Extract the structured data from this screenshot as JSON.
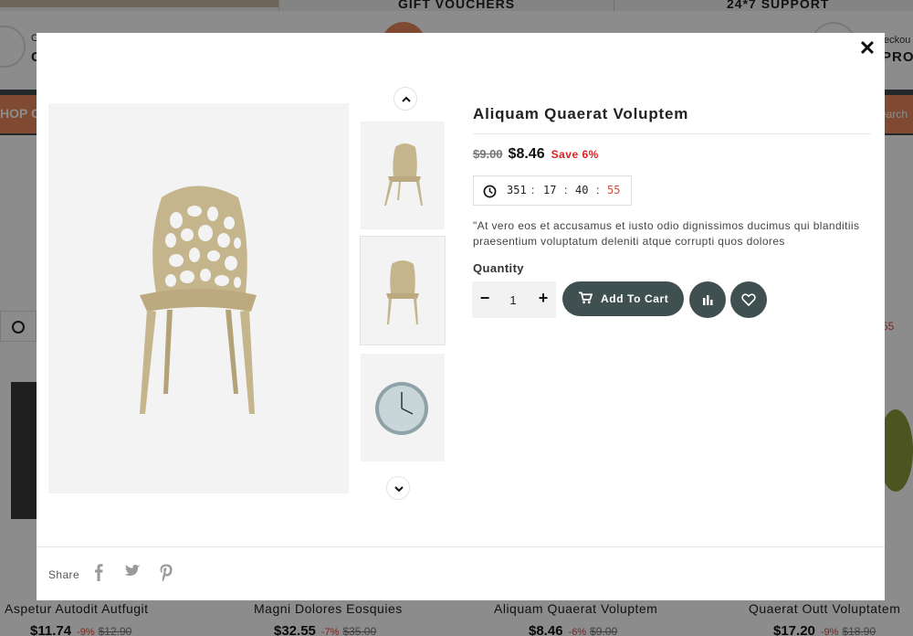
{
  "background": {
    "topbar": {
      "gift": "GIFT VOUCHERS",
      "support": "24*7 SUPPORT"
    },
    "header": {
      "left_small": "C",
      "left_big": "G",
      "right_small": "eckou",
      "right_big": "PROD"
    },
    "nav": {
      "shop_categories": "HOP CA",
      "search": "earch"
    },
    "timer_right": "55",
    "products": [
      {
        "name": "Aspetur Autodit Autfugit",
        "price": "$11.74",
        "discount": "-9%",
        "old_price": "$12.90"
      },
      {
        "name": "Magni Dolores Eosquies",
        "price": "$32.55",
        "discount": "-7%",
        "old_price": "$35.00"
      },
      {
        "name": "Aliquam Quaerat Voluptem",
        "price": "$8.46",
        "discount": "-6%",
        "old_price": "$9.00"
      },
      {
        "name": "Quaerat Outt Voluptatem",
        "price": "$17.20",
        "discount": "-9%",
        "old_price": "$18.90"
      }
    ]
  },
  "modal": {
    "close_label": "✕",
    "product": {
      "title": "Aliquam Quaerat Voluptem",
      "old_price": "$9.00",
      "price": "$8.46",
      "save": "Save 6%",
      "countdown": {
        "days": "351",
        "hours": "17",
        "minutes": "40",
        "seconds": "55"
      },
      "description": "\"At vero eos et accusamus et iusto odio dignissimos ducimus qui blanditiis praesentium voluptatum deleniti atque corrupti quos dolores",
      "quantity_label": "Quantity",
      "quantity_value": "1",
      "add_to_cart_label": "Add To Cart"
    },
    "thumbnails": [
      {
        "icon": "chair-icon"
      },
      {
        "icon": "chair-icon"
      },
      {
        "icon": "wall-clock-icon"
      }
    ],
    "share_label": "Share",
    "social": [
      "facebook-icon",
      "twitter-icon",
      "pinterest-icon"
    ]
  },
  "colors": {
    "accent": "#404f4f",
    "sale_red": "#e0201e",
    "brand_orange": "#e8885a",
    "chair": "#c4b58c"
  }
}
